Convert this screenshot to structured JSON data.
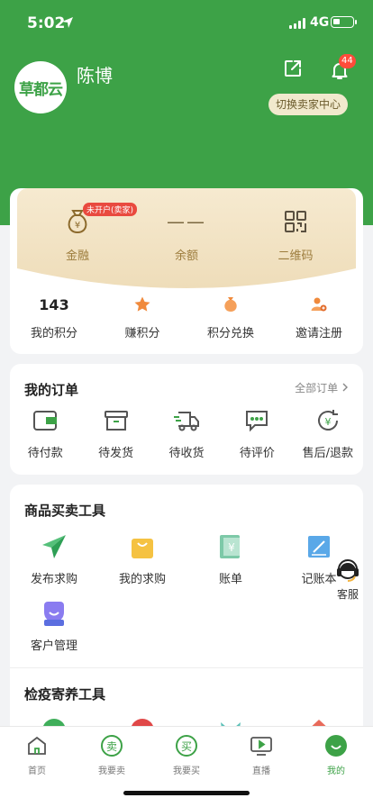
{
  "status": {
    "time": "5:02",
    "network": "4G"
  },
  "profile": {
    "avatar_text": "草都云",
    "name": "陈博",
    "notification_count": "44",
    "switch_label": "切换卖家中心"
  },
  "finance": {
    "tag": "未开户(卖家)",
    "items": [
      {
        "label": "金融",
        "icon": "money-bag-icon"
      },
      {
        "label": "余额",
        "value": "——"
      },
      {
        "label": "二维码",
        "icon": "qr-code-icon"
      }
    ]
  },
  "points": [
    {
      "value": "143",
      "label": "我的积分"
    },
    {
      "label": "赚积分",
      "icon": "star-icon"
    },
    {
      "label": "积分兑换",
      "icon": "gift-bag-icon"
    },
    {
      "label": "邀请注册",
      "icon": "invite-user-icon"
    }
  ],
  "orders": {
    "title": "我的订单",
    "all_label": "全部订单",
    "items": [
      {
        "label": "待付款",
        "icon": "wallet-icon"
      },
      {
        "label": "待发货",
        "icon": "box-icon"
      },
      {
        "label": "待收货",
        "icon": "truck-icon"
      },
      {
        "label": "待评价",
        "icon": "comment-icon"
      },
      {
        "label": "售后/退款",
        "icon": "refund-icon"
      }
    ]
  },
  "tools": {
    "title": "商品买卖工具",
    "items": [
      {
        "label": "发布求购",
        "icon": "paper-plane-icon"
      },
      {
        "label": "我的求购",
        "icon": "shopping-bag-icon"
      },
      {
        "label": "账单",
        "icon": "bill-icon"
      },
      {
        "label": "记账本",
        "icon": "ledger-icon"
      },
      {
        "label": "客户管理",
        "icon": "customer-icon"
      }
    ]
  },
  "quarantine": {
    "title": "检疫寄养工具"
  },
  "support": {
    "label": "客服"
  },
  "tabbar": [
    {
      "label": "首页",
      "icon": "home-icon"
    },
    {
      "label": "我要卖",
      "icon": "sell-icon"
    },
    {
      "label": "我要买",
      "icon": "buy-icon"
    },
    {
      "label": "直播",
      "icon": "live-icon"
    },
    {
      "label": "我的",
      "icon": "profile-icon",
      "active": true
    }
  ],
  "colors": {
    "brand_green": "#3da247",
    "badge_red": "#ff4b3a",
    "gold": "#9c7c3c",
    "orange": "#f08a3c"
  }
}
